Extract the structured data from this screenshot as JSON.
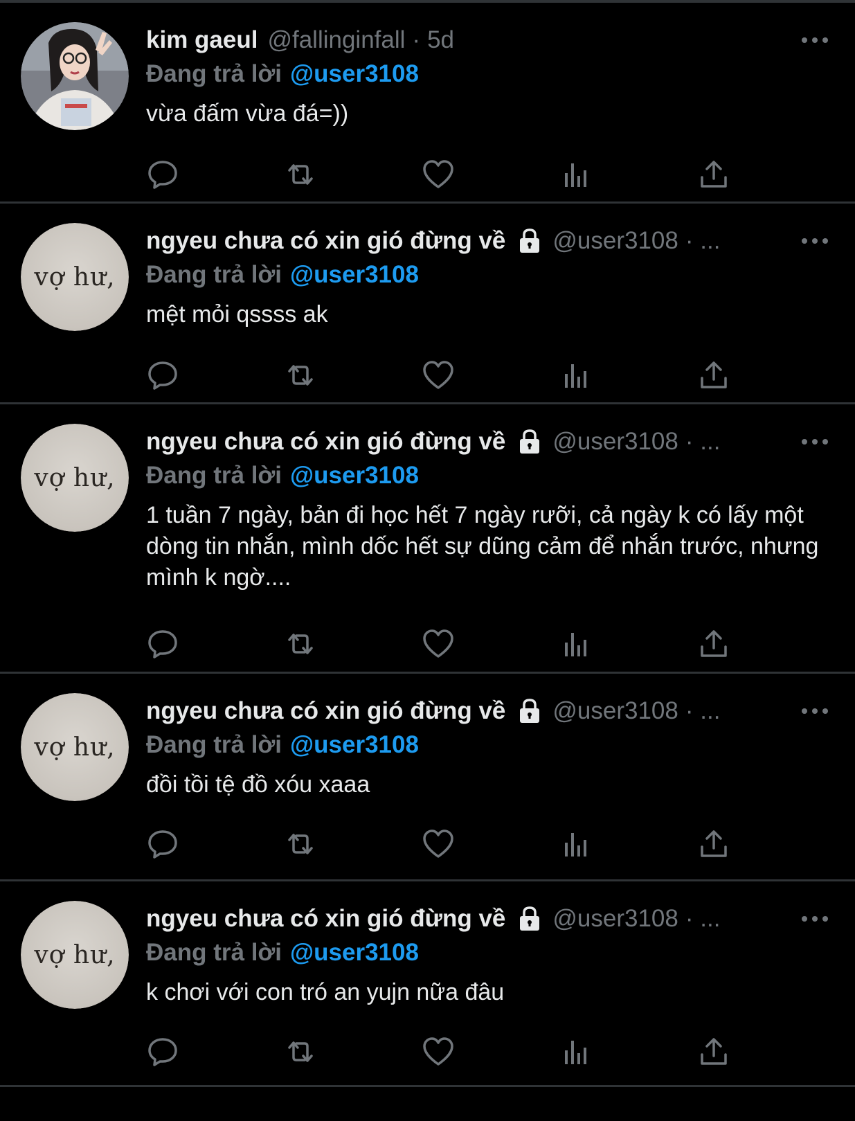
{
  "colors": {
    "background": "#000000",
    "divider": "#2f3336",
    "text_primary": "#e7e9ea",
    "text_secondary": "#71767b",
    "link_blue": "#1d9bf0"
  },
  "tweets": [
    {
      "display_name": "kim gaeul",
      "handle": "@fallinginfall",
      "separator": "·",
      "time": "5d",
      "locked": false,
      "avatar_type": "photo",
      "reply_prefix": "Đang trả lời",
      "reply_to": "@user3108",
      "body": "vừa đấm vừa đá=))",
      "more_icon": "more-horizontal-icon",
      "actions": [
        "reply-icon",
        "retweet-icon",
        "like-icon",
        "views-icon",
        "share-icon"
      ]
    },
    {
      "display_name": "ngyeu chưa có xin gió đừng về",
      "handle": "@user3108",
      "separator": "· ...",
      "time": "",
      "locked": true,
      "avatar_type": "text",
      "avatar_text": "vợ hư,",
      "reply_prefix": "Đang trả lời",
      "reply_to": "@user3108",
      "body": "mệt mỏi qssss ak",
      "more_icon": "more-horizontal-icon",
      "actions": [
        "reply-icon",
        "retweet-icon",
        "like-icon",
        "views-icon",
        "share-icon"
      ]
    },
    {
      "display_name": "ngyeu chưa có xin gió đừng về",
      "handle": "@user3108",
      "separator": "· ...",
      "time": "",
      "locked": true,
      "avatar_type": "text",
      "avatar_text": "vợ hư,",
      "reply_prefix": "Đang trả lời",
      "reply_to": "@user3108",
      "body": "1 tuần 7 ngày, bản đi học hết 7 ngày rưỡi,  cả ngày k có lấy một dòng tin nhắn, mình dốc hết sự dũng cảm để nhắn trước, nhưng mình k ngờ....",
      "more_icon": "more-horizontal-icon",
      "actions": [
        "reply-icon",
        "retweet-icon",
        "like-icon",
        "views-icon",
        "share-icon"
      ]
    },
    {
      "display_name": "ngyeu chưa có xin gió đừng về",
      "handle": "@user3108",
      "separator": "· ...",
      "time": "",
      "locked": true,
      "avatar_type": "text",
      "avatar_text": "vợ hư,",
      "reply_prefix": "Đang trả lời",
      "reply_to": "@user3108",
      "body": "đồi tồi tệ đồ xóu xaaa",
      "more_icon": "more-horizontal-icon",
      "actions": [
        "reply-icon",
        "retweet-icon",
        "like-icon",
        "views-icon",
        "share-icon"
      ]
    },
    {
      "display_name": "ngyeu chưa có xin gió đừng về",
      "handle": "@user3108",
      "separator": "· ...",
      "time": "",
      "locked": true,
      "avatar_type": "text",
      "avatar_text": "vợ hư,",
      "reply_prefix": "Đang trả lời",
      "reply_to": "@user3108",
      "body": "k chơi với con tró an yujn nữa đâu",
      "more_icon": "more-horizontal-icon",
      "actions": [
        "reply-icon",
        "retweet-icon",
        "like-icon",
        "views-icon",
        "share-icon"
      ]
    }
  ]
}
